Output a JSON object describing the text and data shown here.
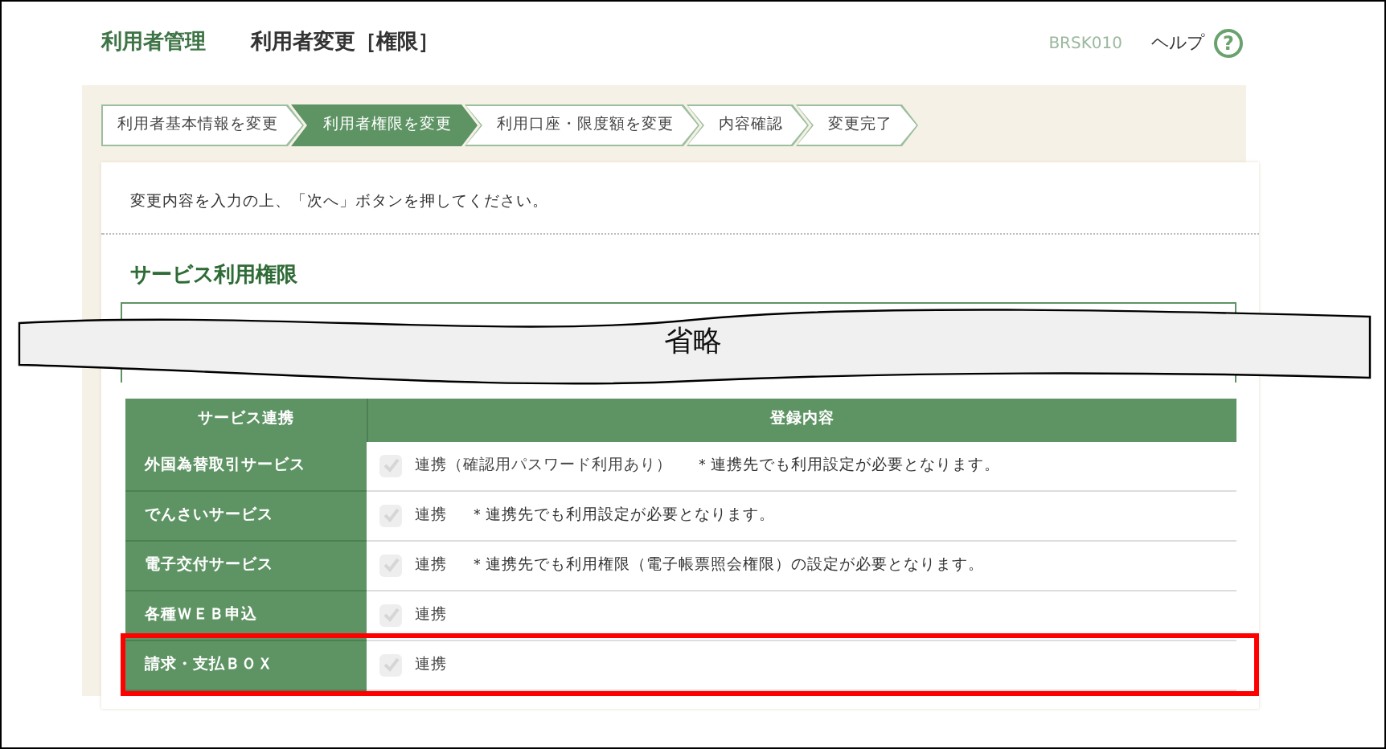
{
  "header": {
    "section": "利用者管理",
    "title": "利用者変更［権限］",
    "screen_id": "BRSK010",
    "help": "ヘルプ",
    "help_icon": "?"
  },
  "steps": [
    {
      "label": "利用者基本情報を変更",
      "selected": false
    },
    {
      "label": "利用者権限を変更",
      "selected": true
    },
    {
      "label": "利用口座・限度額を変更",
      "selected": false
    },
    {
      "label": "内容確認",
      "selected": false
    },
    {
      "label": "変更完了",
      "selected": false
    }
  ],
  "instruction": "変更内容を入力の上、「次へ」ボタンを押してください。",
  "section_title": "サービス利用権限",
  "omission_banner": "省略",
  "table": {
    "columns": [
      "サービス連携",
      "登録内容"
    ],
    "rows": [
      {
        "service": "外国為替取引サービス",
        "checked": true,
        "disabled": true,
        "label": "連携（確認用パスワード利用あり）",
        "note": "＊連携先でも利用設定が必要となります。",
        "highlighted": false
      },
      {
        "service": "でんさいサービス",
        "checked": true,
        "disabled": true,
        "label": "連携",
        "note": "＊連携先でも利用設定が必要となります。",
        "highlighted": false
      },
      {
        "service": "電子交付サービス",
        "checked": true,
        "disabled": true,
        "label": "連携",
        "note": "＊連携先でも利用権限（電子帳票照会権限）の設定が必要となります。",
        "highlighted": false
      },
      {
        "service": "各種ＷＥＢ申込",
        "checked": true,
        "disabled": true,
        "label": "連携",
        "highlighted": false
      },
      {
        "service": "請求・支払ＢＯＸ",
        "checked": true,
        "disabled": true,
        "label": "連携",
        "highlighted": true
      }
    ]
  }
}
